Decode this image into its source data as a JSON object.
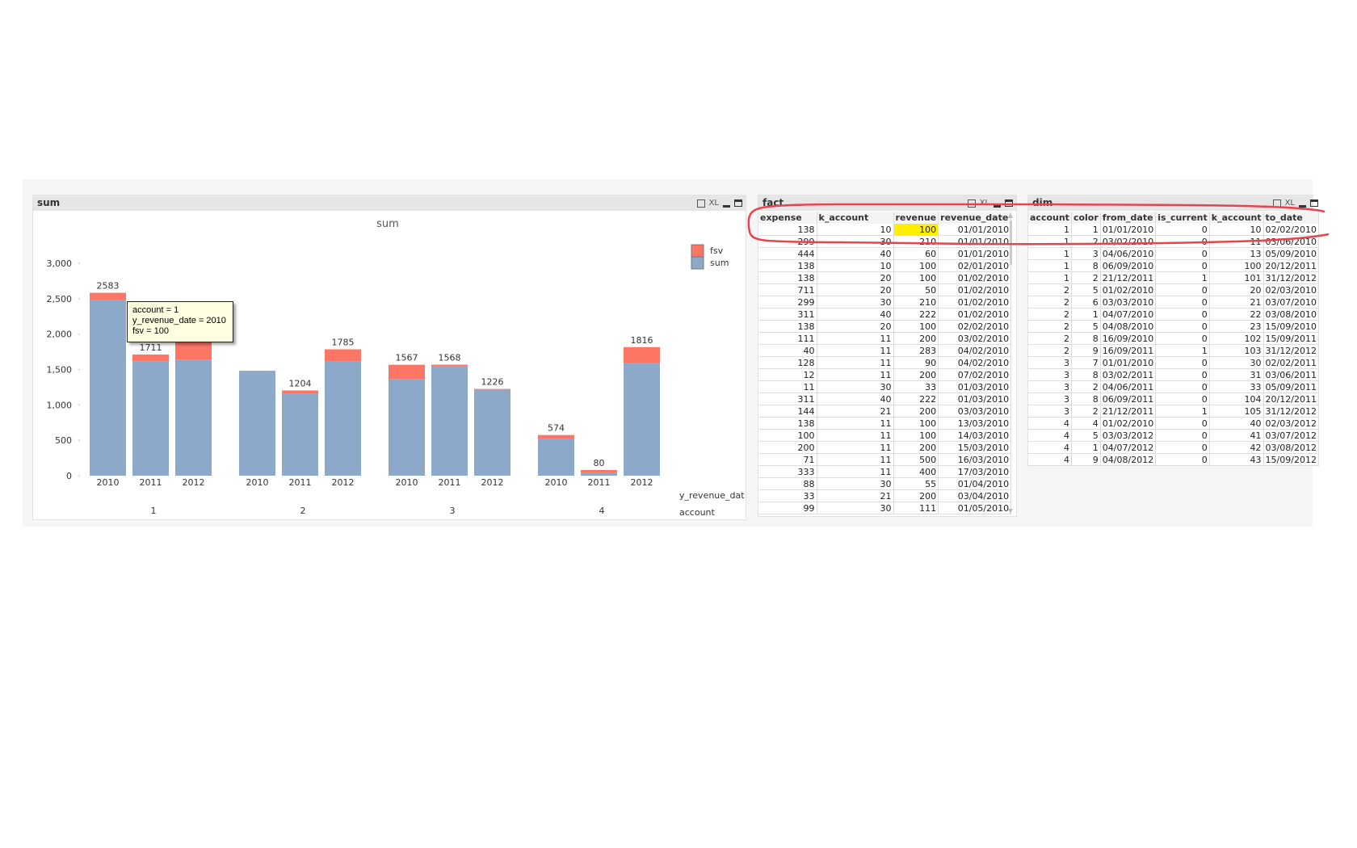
{
  "colors": {
    "fsv": "#fd7565",
    "sum": "#8ca9c9",
    "annotation": "#e8444f",
    "highlight": "#ffee00"
  },
  "sum_panel": {
    "title": "sum",
    "icons": [
      "print-icon",
      "xl-icon",
      "minimize-icon",
      "maximize-icon"
    ],
    "xl_label": "XL"
  },
  "chart_data": {
    "type": "bar",
    "stacked": true,
    "title": "sum",
    "ylim": [
      0,
      3000
    ],
    "yticks": [
      "0",
      "500",
      "1,000",
      "1,500",
      "2,000",
      "2,500",
      "3,000"
    ],
    "ytick_values": [
      0,
      500,
      1000,
      1500,
      2000,
      2500,
      3000
    ],
    "xlabel_inner": "y_revenue_dat",
    "xlabel_outer": "account",
    "groups": [
      "1",
      "2",
      "3",
      "4"
    ],
    "categories": [
      "2010",
      "2011",
      "2012"
    ],
    "legend": {
      "position": "top-right",
      "entries": [
        "fsv",
        "sum"
      ]
    },
    "series": [
      {
        "name": "sum",
        "values": [
          [
            2483,
            1611,
            1634
          ],
          [
            1482,
            1163,
            1619
          ],
          [
            1360,
            1543,
            1216
          ],
          [
            516,
            46,
            1596
          ]
        ]
      },
      {
        "name": "fsv",
        "values": [
          [
            100,
            100,
            300
          ],
          [
            0,
            41,
            166
          ],
          [
            207,
            25,
            10
          ],
          [
            58,
            34,
            220
          ]
        ]
      }
    ],
    "labels": [
      [
        "2583",
        "1711",
        ""
      ],
      [
        "",
        "1204",
        "1785"
      ],
      [
        "1567",
        "1568",
        "1226"
      ],
      [
        "574",
        "80",
        "1816"
      ]
    ]
  },
  "tooltip": {
    "lines": [
      "account = 1",
      "y_revenue_date = 2010",
      "fsv = 100"
    ]
  },
  "fact": {
    "title": "fact",
    "xl_label": "XL",
    "columns": [
      "expense",
      "k_account",
      "revenue",
      "revenue_date"
    ],
    "rows": [
      [
        "138",
        "10",
        "100",
        "01/01/2010"
      ],
      [
        "299",
        "30",
        "210",
        "01/01/2010"
      ],
      [
        "444",
        "40",
        "60",
        "01/01/2010"
      ],
      [
        "138",
        "10",
        "100",
        "02/01/2010"
      ],
      [
        "138",
        "20",
        "100",
        "01/02/2010"
      ],
      [
        "711",
        "20",
        "50",
        "01/02/2010"
      ],
      [
        "299",
        "30",
        "210",
        "01/02/2010"
      ],
      [
        "311",
        "40",
        "222",
        "01/02/2010"
      ],
      [
        "138",
        "20",
        "100",
        "02/02/2010"
      ],
      [
        "111",
        "11",
        "200",
        "03/02/2010"
      ],
      [
        "40",
        "11",
        "283",
        "04/02/2010"
      ],
      [
        "128",
        "11",
        "90",
        "04/02/2010"
      ],
      [
        "12",
        "11",
        "200",
        "07/02/2010"
      ],
      [
        "11",
        "30",
        "33",
        "01/03/2010"
      ],
      [
        "311",
        "40",
        "222",
        "01/03/2010"
      ],
      [
        "144",
        "21",
        "200",
        "03/03/2010"
      ],
      [
        "138",
        "11",
        "100",
        "13/03/2010"
      ],
      [
        "100",
        "11",
        "100",
        "14/03/2010"
      ],
      [
        "200",
        "11",
        "200",
        "15/03/2010"
      ],
      [
        "71",
        "11",
        "500",
        "16/03/2010"
      ],
      [
        "333",
        "11",
        "400",
        "17/03/2010"
      ],
      [
        "88",
        "30",
        "55",
        "01/04/2010"
      ],
      [
        "33",
        "21",
        "200",
        "03/04/2010"
      ],
      [
        "99",
        "30",
        "111",
        "01/05/2010"
      ]
    ]
  },
  "dim": {
    "title": "dim",
    "xl_label": "XL",
    "columns": [
      "account",
      "color",
      "from_date",
      "is_current",
      "k_account",
      "to_date"
    ],
    "rows": [
      [
        "1",
        "1",
        "01/01/2010",
        "0",
        "10",
        "02/02/2010"
      ],
      [
        "1",
        "2",
        "03/02/2010",
        "0",
        "11",
        "03/06/2010"
      ],
      [
        "1",
        "3",
        "04/06/2010",
        "0",
        "13",
        "05/09/2010"
      ],
      [
        "1",
        "8",
        "06/09/2010",
        "0",
        "100",
        "20/12/2011"
      ],
      [
        "1",
        "2",
        "21/12/2011",
        "1",
        "101",
        "31/12/2012"
      ],
      [
        "2",
        "5",
        "01/02/2010",
        "0",
        "20",
        "02/03/2010"
      ],
      [
        "2",
        "6",
        "03/03/2010",
        "0",
        "21",
        "03/07/2010"
      ],
      [
        "2",
        "1",
        "04/07/2010",
        "0",
        "22",
        "03/08/2010"
      ],
      [
        "2",
        "5",
        "04/08/2010",
        "0",
        "23",
        "15/09/2010"
      ],
      [
        "2",
        "8",
        "16/09/2010",
        "0",
        "102",
        "15/09/2011"
      ],
      [
        "2",
        "9",
        "16/09/2011",
        "1",
        "103",
        "31/12/2012"
      ],
      [
        "3",
        "7",
        "01/01/2010",
        "0",
        "30",
        "02/02/2011"
      ],
      [
        "3",
        "8",
        "03/02/2011",
        "0",
        "31",
        "03/06/2011"
      ],
      [
        "3",
        "2",
        "04/06/2011",
        "0",
        "33",
        "05/09/2011"
      ],
      [
        "3",
        "8",
        "06/09/2011",
        "0",
        "104",
        "20/12/2011"
      ],
      [
        "3",
        "2",
        "21/12/2011",
        "1",
        "105",
        "31/12/2012"
      ],
      [
        "4",
        "4",
        "01/02/2010",
        "0",
        "40",
        "02/03/2012"
      ],
      [
        "4",
        "5",
        "03/03/2012",
        "0",
        "41",
        "03/07/2012"
      ],
      [
        "4",
        "1",
        "04/07/2012",
        "0",
        "42",
        "03/08/2012"
      ],
      [
        "4",
        "9",
        "04/08/2012",
        "0",
        "43",
        "15/09/2012"
      ]
    ]
  }
}
